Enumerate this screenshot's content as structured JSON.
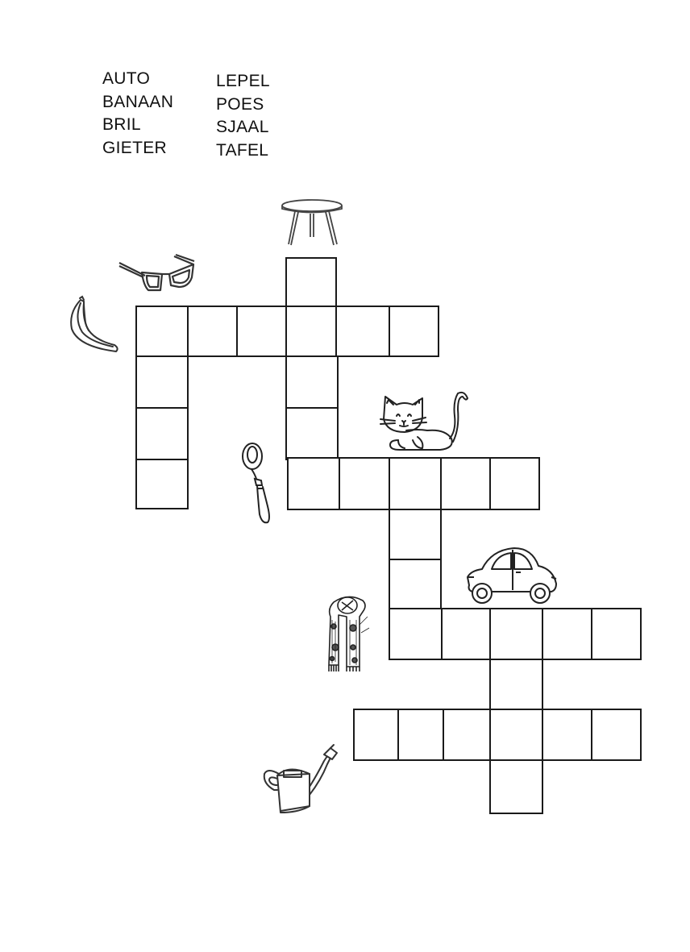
{
  "word_list": {
    "left": [
      "AUTO",
      "BANAAN",
      "BRIL",
      "GIETER"
    ],
    "right": [
      "LEPEL",
      "POES",
      "SJAAL",
      "TAFEL"
    ]
  },
  "pictures": [
    "table-icon",
    "glasses-icon",
    "banana-icon",
    "cat-icon",
    "spoon-icon",
    "car-icon",
    "scarf-icon",
    "watering-can-icon"
  ]
}
